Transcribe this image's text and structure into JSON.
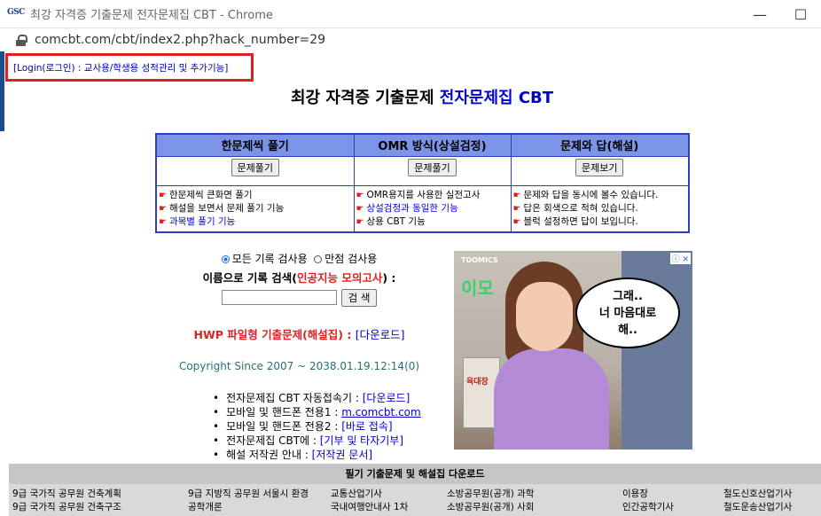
{
  "window": {
    "favicon_text": "GSC",
    "title": "최강 자격증 기출문제 전자문제집 CBT - Chrome",
    "minimize_glyph": "—",
    "maximize_glyph": "☐"
  },
  "address_bar": {
    "url": "comcbt.com/cbt/index2.php?hack_number=29"
  },
  "login_link": "[Login(로그인) : 교사용/학생용 성적관리 및 추가기능]",
  "title": {
    "prefix": "최강 자격증 기출문제 ",
    "highlight": "전자문제집 CBT"
  },
  "modes": [
    {
      "header": "한문제씩 풀기",
      "button": "문제풀기",
      "lines": [
        {
          "text": "한문제씩 큰화면 풀기",
          "link": false
        },
        {
          "text": "해설을 보면서 문제 풀기 기능",
          "link": false
        },
        {
          "text": "과목별 풀기 기능",
          "link": true
        }
      ]
    },
    {
      "header": "OMR 방식(상설검정)",
      "button": "문제풀기",
      "lines": [
        {
          "text": "OMR용지를 사용한 실전고사",
          "link": false
        },
        {
          "text": "상설검정과 동일한 기능",
          "link": true
        },
        {
          "text": "상용 CBT 기능",
          "link": false
        }
      ]
    },
    {
      "header": "문제와 답(해설)",
      "button": "문제보기",
      "lines": [
        {
          "text": "문제와 답을 동시에 볼수 있습니다.",
          "link": false
        },
        {
          "text": "답은 회색으로 적혀 있습니다.",
          "link": false
        },
        {
          "text": "블럭 설정하면 답이 보입니다.",
          "link": false
        }
      ]
    }
  ],
  "search": {
    "radio_all": "모든 기록 검사용",
    "radio_full": "만점 검사용",
    "label_prefix": "이름으로 기록 검색(",
    "label_highlight": "인공지능 모의고사",
    "label_suffix": ") :",
    "button": "검 색",
    "input_value": ""
  },
  "hwp": {
    "label": "HWP 파일형 기출문제(해설집) : ",
    "link": "[다운로드]"
  },
  "copyright": "Copyright Since 2007 ~ 2038.01.19.12:14(0)",
  "links": [
    {
      "label": "전자문제집 CBT 자동접속기 : ",
      "link": "[다운로드]",
      "underline": false
    },
    {
      "label": "모바일 및 핸드폰 전용1 : ",
      "link": "m.comcbt.com",
      "underline": true
    },
    {
      "label": "모바일 및 핸드폰 전용2 : ",
      "link": "[바로 접속]",
      "underline": false
    },
    {
      "label": "전자문제집 CBT에 : ",
      "link": "[기부 및 타자기부]",
      "underline": false
    },
    {
      "label": "해설 저작권 안내 : ",
      "link": "[저작권 문서]",
      "underline": false
    }
  ],
  "ad": {
    "brand": "TOOMICS",
    "logo": "이모",
    "bubble_lines": [
      "그래..",
      "너 마음대로",
      "해.."
    ],
    "box_text": "육대장",
    "icons": "ⓘ ✕"
  },
  "footer": {
    "heading": "필기 기출문제 및 해설집 다운로드",
    "col1": [
      "9급 국가직 공무원 건축계획",
      "9급 국가직 공무원 건축구조"
    ],
    "col2": [
      "9급 지방직 공무원 서울시 환경",
      "공학개론"
    ],
    "col3": [
      "교통산업기사",
      "국내여행안내사 1차"
    ],
    "col4": [
      "소방공무원(공개) 과학",
      "소방공무원(공개) 사회"
    ],
    "col5": [
      "이용장",
      "인간공학기사"
    ],
    "col6": [
      "철도신호산업기사",
      "철도운송산업기사"
    ]
  }
}
